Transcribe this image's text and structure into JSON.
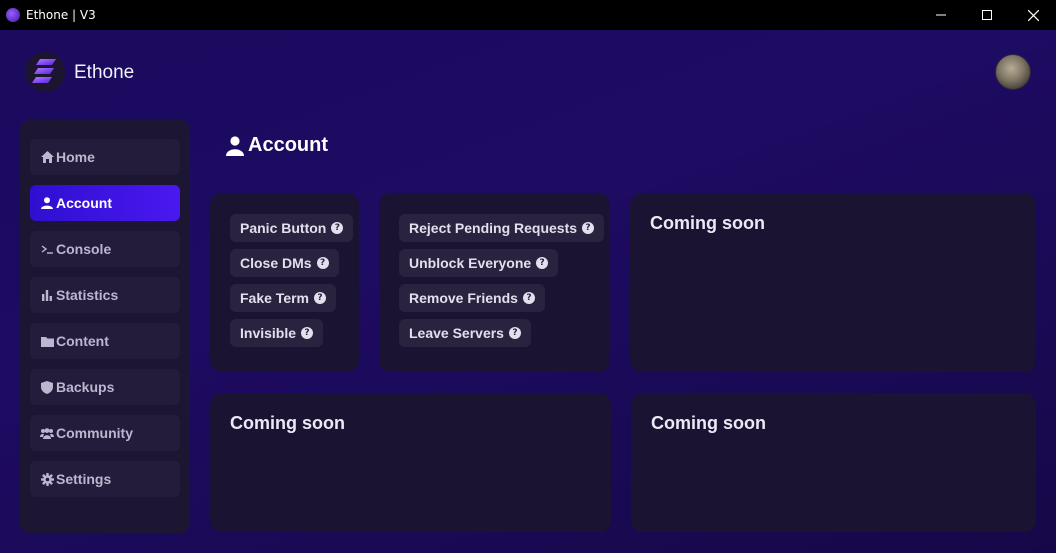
{
  "window": {
    "title": "Ethone | V3"
  },
  "header": {
    "brand": "Ethone"
  },
  "sidebar": {
    "items": [
      {
        "label": "Home",
        "icon": "home-icon"
      },
      {
        "label": "Account",
        "icon": "user-icon",
        "active": true
      },
      {
        "label": "Console",
        "icon": "terminal-icon"
      },
      {
        "label": "Statistics",
        "icon": "bar-chart-icon"
      },
      {
        "label": "Content",
        "icon": "folder-icon"
      },
      {
        "label": "Backups",
        "icon": "shield-icon"
      },
      {
        "label": "Community",
        "icon": "users-icon"
      },
      {
        "label": "Settings",
        "icon": "gear-icon"
      }
    ]
  },
  "main": {
    "title": "Account",
    "card1": {
      "buttons": [
        "Panic Button",
        "Close DMs",
        "Fake Term",
        "Invisible"
      ]
    },
    "card2": {
      "buttons": [
        "Reject Pending Requests",
        "Unblock Everyone",
        "Remove Friends",
        "Leave Servers"
      ]
    },
    "card3": {
      "title": "Coming soon"
    },
    "card4": {
      "title": "Coming soon"
    },
    "card5": {
      "title": "Coming soon"
    }
  },
  "colors": {
    "accent": "#3a14e6",
    "background": "#1b0a5e",
    "card": "#1b1332"
  }
}
